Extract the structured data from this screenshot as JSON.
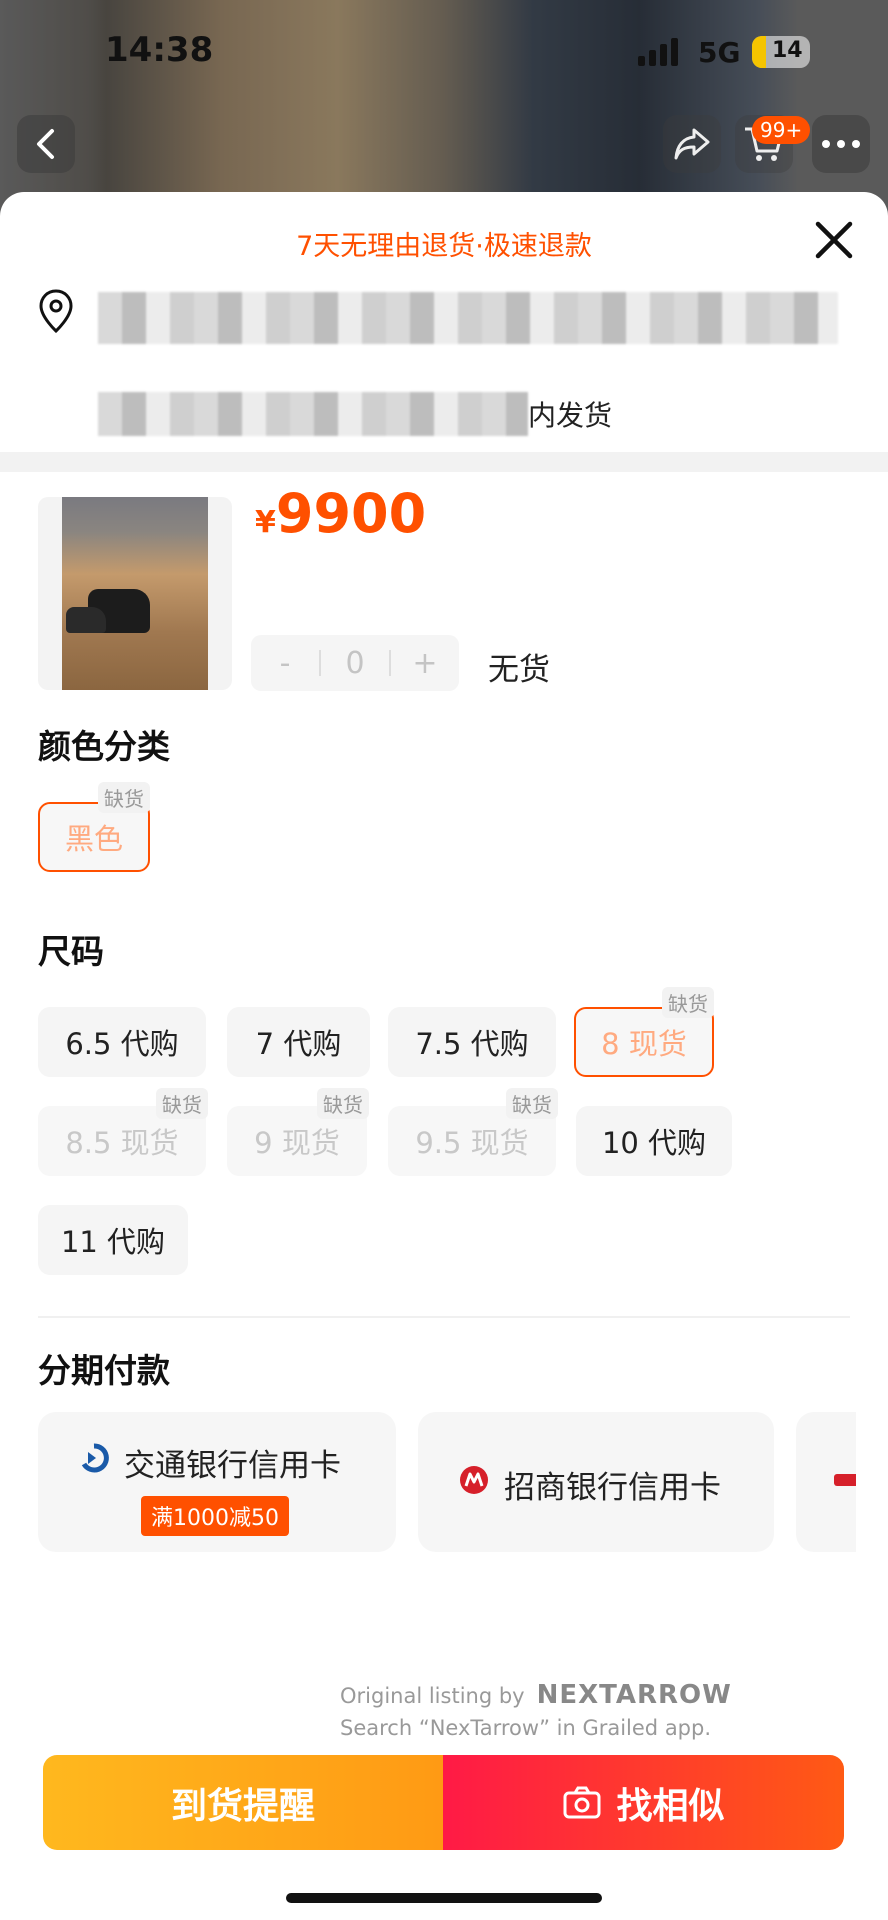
{
  "status_bar": {
    "time": "14:38",
    "network": "5G",
    "battery_level": "14"
  },
  "top_nav": {
    "cart_badge": "99+"
  },
  "sheet": {
    "promo_banner": "7天无理由退货·极速退款",
    "shipping_suffix": "内发货",
    "price_currency": "¥",
    "price_amount": "9900",
    "quantity": "0",
    "quantity_minus": "-",
    "quantity_plus": "+",
    "stock_status": "无货",
    "out_of_stock_tag": "缺货"
  },
  "color_section": {
    "title": "颜色分类",
    "options": [
      {
        "label": "黑色",
        "selected": true,
        "out_of_stock": true
      }
    ]
  },
  "size_section": {
    "title": "尺码",
    "options": [
      {
        "label": "6.5 代购",
        "out_of_stock": false
      },
      {
        "label": "7 代购",
        "out_of_stock": false
      },
      {
        "label": "7.5 代购",
        "out_of_stock": false
      },
      {
        "label": "8 现货",
        "selected": true,
        "out_of_stock": true
      },
      {
        "label": "8.5 现货",
        "out_of_stock": true
      },
      {
        "label": "9 现货",
        "out_of_stock": true
      },
      {
        "label": "9.5 现货",
        "out_of_stock": true
      },
      {
        "label": "10 代购",
        "out_of_stock": false
      },
      {
        "label": "11 代购",
        "out_of_stock": false
      }
    ]
  },
  "installment_section": {
    "title": "分期付款",
    "cards": [
      {
        "bank": "交通银行信用卡",
        "promo": "满1000减50"
      },
      {
        "bank": "招商银行信用卡"
      }
    ]
  },
  "watermark": {
    "line1": "Original listing by",
    "brand": "NEXTARROW",
    "line2": "Search “NexTarrow” in Grailed app."
  },
  "actions": {
    "notify_label": "到货提醒",
    "find_similar_label": "找相似"
  },
  "colors": {
    "accent": "#ff5000",
    "notify_btn": "#ffa718",
    "similar_btn": "#ff2a3c"
  }
}
